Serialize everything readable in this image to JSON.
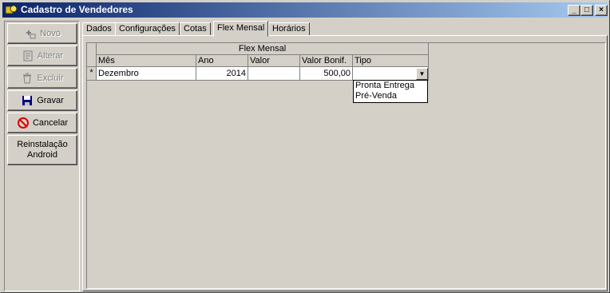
{
  "window": {
    "title": "Cadastro de Vendedores",
    "minimize": "_",
    "maximize": "□",
    "close": "×"
  },
  "sidebar": {
    "novo": "Novo",
    "alterar": "Alterar",
    "excluir": "Excluir",
    "gravar": "Gravar",
    "cancelar": "Cancelar",
    "reinstalacao_line1": "Reinstalação",
    "reinstalacao_line2": "Android"
  },
  "tabs": [
    "Dados",
    "Configurações",
    "Cotas",
    "Flex Mensal",
    "Horários"
  ],
  "grid": {
    "group_header": "Flex Mensal",
    "columns": [
      "Mês",
      "Ano",
      "Valor",
      "Valor Bonif.",
      "Tipo"
    ],
    "row_indicator": "*",
    "row": {
      "mes": "Dezembro",
      "ano": "2014",
      "valor": "",
      "valor_bonif": "500,00",
      "tipo": ""
    },
    "dropdown_arrow": "▼"
  },
  "tipo_options": [
    "Pronta Entrega",
    "Pré-Venda"
  ]
}
